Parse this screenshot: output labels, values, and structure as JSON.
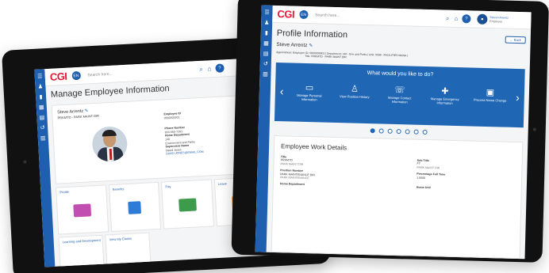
{
  "colors": {
    "rail": "#1f5fb0",
    "banner": "#1f66b5",
    "logo": "#e31937",
    "profile_tile": "#c24eb1",
    "benefits_tile": "#2f7bd8",
    "pay_tile": "#3d9b4c",
    "leave_tile": "#f3a24d",
    "fifth_tile": "#c24eb1"
  },
  "icons": [
    "menu-icon",
    "search-icon",
    "home-icon",
    "help-icon",
    "user-avatar-icon"
  ],
  "back_tablet": {
    "logo": "CGI",
    "lang": "EN",
    "search_placeholder": "Search here...",
    "page_title": "Manage Employee Information",
    "employee_name": "Steve Arrentz",
    "employee_position": "PRKMTD - PARK MAINT DIR",
    "fields": {
      "employee_id_label": "Employee ID",
      "employee_id": "0000000001",
      "phone_label": "Phone Number",
      "phone": "804-555-7261",
      "home_dept_label": "Home Department",
      "home_dept_code": "140",
      "home_dept_name": "Environment and Parks",
      "supervisor_label": "Supervisor Name",
      "supervisor_name": "David Jones",
      "supervisor_email": "DAVID.JONES@EMAIL.COM",
      "hire_label": "Date of Hire",
      "hire": "04/01/2012",
      "work_loc_label": "Work Location",
      "work_loc_1": "101 MAIN ST",
      "work_loc_2": "22033",
      "home_unit_label": "Home Unit",
      "home_unit_code": "0508",
      "home_unit_name": "FACILITIES MANA"
    },
    "tiles": [
      "Profile",
      "Benefits",
      "Pay",
      "Leave"
    ],
    "tiles_row2": [
      "Learning and Development",
      "View My Claims"
    ]
  },
  "front_tablet": {
    "logo": "CGI",
    "lang": "EN",
    "search_placeholder": "Search here...",
    "user_name": "Steven Arrentz",
    "user_role": "Employee",
    "page_title": "Profile Information",
    "back_label": "Back",
    "employee_name": "Steve Arrentz",
    "appointment_line1": "Appointment:  Employee ID: 0000000001  |  Department: 140 - Env and Parks  |  Unit: 0508 - FACILITIES MANA  |",
    "appointment_line2": "Title: PRKMTD - PARK MAINT DIR",
    "banner_question": "What would you like to do?",
    "actions": [
      {
        "label": "Manage Personal Information",
        "icon": "id-card-icon"
      },
      {
        "label": "View Position History",
        "icon": "people-icon"
      },
      {
        "label": "Manage Contact Information",
        "icon": "phone-book-icon"
      },
      {
        "label": "Manage Emergency Information",
        "icon": "emergency-icon"
      },
      {
        "label": "Process Name Change",
        "icon": "name-card-icon"
      }
    ],
    "page_count": 7,
    "active_page": 1,
    "work_details_title": "Employee Work Details",
    "details": {
      "title_label": "Title",
      "title_value": "PRKMTD",
      "title_sub": "PARK MAINT DIR",
      "position_label": "Position Number",
      "position_value": "PARK MAINTENANCE DIR",
      "position_sub": "PARK MAINTENANCE",
      "home_dept_label": "Home Department",
      "subtitle_label": "Sub Title",
      "subtitle_value": "FT",
      "subtitle_sub": "PARK MAINT DIR",
      "fte_label": "Percentage Full Time",
      "fte_value": "1.0000",
      "home_unit_label": "Home Unit"
    }
  }
}
